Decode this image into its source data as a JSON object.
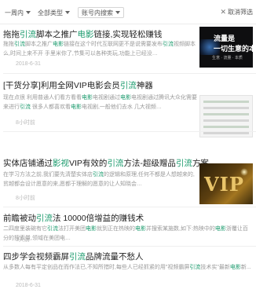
{
  "filters": [
    {
      "label": "一周内",
      "boxed": false
    },
    {
      "label": "全部类型",
      "boxed": false
    },
    {
      "label": "账号内搜索",
      "boxed": true
    }
  ],
  "cancel_label": "取消筛选",
  "results": [
    {
      "title_parts": [
        [
          "拖拖",
          false
        ],
        [
          "引流",
          true
        ],
        [
          "脚本之推广",
          false
        ],
        [
          "电影",
          true
        ],
        [
          "链接,实现轻松赚钱",
          false
        ]
      ],
      "desc_parts": [
        [
          "拖拖",
          false
        ],
        [
          "引流",
          true
        ],
        [
          "脚本之推广",
          false
        ],
        [
          "电影",
          true
        ],
        [
          "链接在这个时代互联网更不是说需要发布",
          false
        ],
        [
          "引流",
          true
        ],
        [
          "视频脚本么,时间上来不开 手里米你了,节集可以各种类玩,功能上已经没…",
          false
        ]
      ],
      "time": "2018-6-31"
    },
    {
      "title_parts": [
        [
          "[干货分享]利用全网VIP电影会员",
          false
        ],
        [
          "引流",
          true
        ],
        [
          "神器",
          false
        ]
      ],
      "desc_parts": [
        [
          "现在点很 利用普通人们看方看看",
          false
        ],
        [
          "电影",
          true
        ],
        [
          "电视剧通过",
          false
        ],
        [
          "电影",
          true
        ],
        [
          "电视剧通过腾讯大众化需要来进行",
          false
        ],
        [
          "引流",
          true
        ],
        [
          "  很多人都喜欢看",
          false
        ],
        [
          "电影",
          true
        ],
        [
          "电视剧,一般他们去水 几大视频…",
          false
        ]
      ],
      "time": "8小时前"
    },
    {
      "title_parts": [
        [
          "实体店铺通过",
          false
        ],
        [
          "影视",
          true
        ],
        [
          "VIP有效的",
          false
        ],
        [
          "引流",
          true
        ],
        [
          "方法-超级赠品",
          false
        ],
        [
          "引流",
          true
        ],
        [
          "方案",
          false
        ]
      ],
      "desc_parts": [
        [
          "在学习方法之前,我们要先清楚实体店",
          false
        ],
        [
          "引流",
          true
        ],
        [
          "的逻辑和原理,任何不都是人想越来的,贫越都会设计愿意的来,愿都于理解的愿意的让人知晓会…",
          false
        ]
      ],
      "time": "8小时前"
    },
    {
      "title_parts": [
        [
          "前瞻被动",
          false
        ],
        [
          "引流",
          true
        ],
        [
          "法 10000倍增益的赚钱术",
          false
        ]
      ],
      "desc_parts": [
        [
          "二四度里装碗有它",
          false
        ],
        [
          "引流",
          true
        ],
        [
          "法打开美团",
          false
        ],
        [
          "电影",
          true
        ],
        [
          "就到正在热映的",
          false
        ],
        [
          "电影",
          true
        ],
        [
          "并搜索某施数,如下:热映中的",
          false
        ],
        [
          "电影",
          true
        ],
        [
          "浙覆让百分的搜索量,领域在美团电…",
          false
        ]
      ],
      "time": "3天前"
    },
    {
      "title_parts": [
        [
          "四步学会视频霸屏",
          false
        ],
        [
          "引流",
          true
        ],
        [
          "品牌流量不愁人",
          false
        ]
      ],
      "desc_parts": [
        [
          "从多数人每有平定创品在而作法已,不知所措时,每些人已经抓紧的用\"视频霸屏",
          false
        ],
        [
          "引流",
          true
        ],
        [
          "技术实\"最新",
          false
        ],
        [
          "电影",
          true
        ],
        [
          "新...",
          false
        ]
      ],
      "time": "2018-6-31"
    }
  ],
  "thumbs": {
    "first": {
      "line1": "流量是",
      "line2": "一切生意的本质",
      "line3": "生意 · 流量 · 本质"
    },
    "vip": {
      "text": "VIP"
    }
  }
}
